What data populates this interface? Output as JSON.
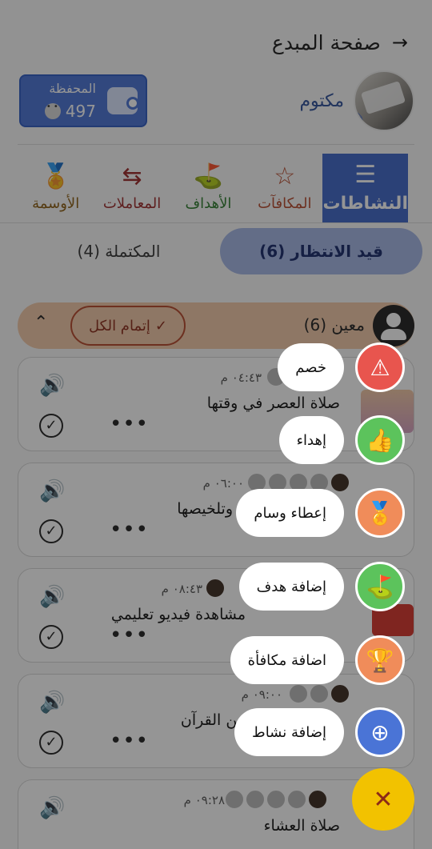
{
  "header": {
    "title": "صفحة المبدع",
    "back_icon": "arrow-right-icon"
  },
  "profile": {
    "name": "مكتوم"
  },
  "wallet": {
    "label": "المحفظة",
    "value": "497"
  },
  "nav": [
    {
      "label": "النشاطات",
      "icon": "checklist-icon"
    },
    {
      "label": "المكافآت",
      "icon": "star-icon"
    },
    {
      "label": "الأهداف",
      "icon": "golf-flag-icon"
    },
    {
      "label": "المعاملات",
      "icon": "swap-arrows-icon"
    },
    {
      "label": "الأوسمة",
      "icon": "medal-icon"
    }
  ],
  "subtabs": {
    "pending": "قيد الانتظار (6)",
    "completed": "المكتملة (4)"
  },
  "group": {
    "name": "معين (6)",
    "complete_all": "إتمام الكل"
  },
  "cards": [
    {
      "time": "٠٤:٤٣ م",
      "title": "صلاة العصر في وقتها"
    },
    {
      "time": "٠٦:٠٠ م",
      "title": "ة وتلخيصها"
    },
    {
      "time": "٠٨:٤٣ م",
      "title": "مشاهدة فيديو تعليمي"
    },
    {
      "time": "٠٩:٠٠ م",
      "title": "من القرآن"
    },
    {
      "time": "٠٩:٢٨ م",
      "title": "صلاة العشاء"
    }
  ],
  "fab_menu": [
    {
      "label": "خصم",
      "icon": "warning-icon",
      "color": "#e8554e"
    },
    {
      "label": "إهداء",
      "icon": "thumbs-up-icon",
      "color": "#5cc35c"
    },
    {
      "label": "إعطاء وسام",
      "icon": "medal-icon",
      "color": "#f08c5a"
    },
    {
      "label": "إضافة هدف",
      "icon": "golf-flag-icon",
      "color": "#5cc35c"
    },
    {
      "label": "اضافة مكافأة",
      "icon": "trophy-icon",
      "color": "#f08c5a"
    },
    {
      "label": "إضافة نشاط",
      "icon": "plus-circle-icon",
      "color": "#4a74d6"
    }
  ],
  "main_fab": {
    "icon": "close-icon",
    "color": "#f2c200"
  }
}
